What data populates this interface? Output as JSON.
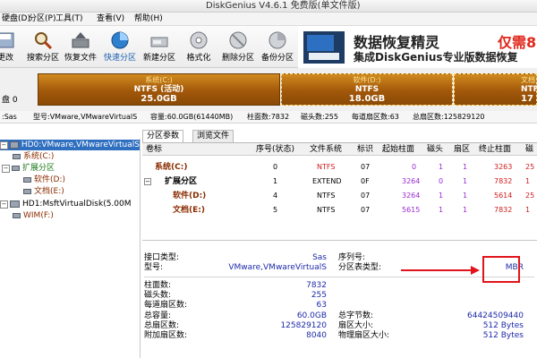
{
  "window": {
    "title": "DiskGenius V4.6.1 免费版(单文件版)"
  },
  "menu": [
    "硬盘(D)",
    "分区(P)",
    "工具(T)",
    "查看(V)",
    "帮助(H)"
  ],
  "toolbar": [
    {
      "label": "更改",
      "icon": "save-icon"
    },
    {
      "label": "搜索分区",
      "icon": "search-icon"
    },
    {
      "label": "恢复文件",
      "icon": "recover-file-icon"
    },
    {
      "label": "快速分区",
      "icon": "quick-partition-icon"
    },
    {
      "label": "新建分区",
      "icon": "new-partition-icon"
    },
    {
      "label": "格式化",
      "icon": "format-icon"
    },
    {
      "label": "删除分区",
      "icon": "delete-partition-icon"
    },
    {
      "label": "备份分区",
      "icon": "backup-partition-icon"
    }
  ],
  "ad": {
    "line1": "数据恢复精灵",
    "line1b": "仅需8",
    "line2": "集成DiskGenius专业版数据恢复"
  },
  "disk_label": "盘 0",
  "partitions_bar": [
    {
      "name": "系统(C:)",
      "fs": "NTFS (活动)",
      "size": "25.0GB"
    },
    {
      "name": "软件(D:)",
      "fs": "NTFS",
      "size": "18.0GB"
    },
    {
      "name": "文档",
      "fs": "NTF",
      "size": "17"
    }
  ],
  "info_bar": {
    "iface": ":Sas",
    "model": "型号:VMware,VMwareVirtualS",
    "capacity": "容量:60.0GB(61440MB)",
    "cyl": "柱面数:7832",
    "heads": "磁头数:255",
    "sectors_track": "每道扇区数:63",
    "total_sectors": "总扇区数:125829120"
  },
  "tree": [
    {
      "label": "HD0:VMware,VMwareVirtualS",
      "level": 0,
      "type": "disk",
      "expander": "-",
      "selected": true
    },
    {
      "label": "系统(C:)",
      "level": 1,
      "type": "part",
      "color": "#8a2c00"
    },
    {
      "label": "扩展分区",
      "level": 1,
      "type": "ext",
      "expander": "-",
      "color": "#1c7a1c"
    },
    {
      "label": "软件(D:)",
      "level": 2,
      "type": "part",
      "color": "#8a2c00"
    },
    {
      "label": "文档(E:)",
      "level": 2,
      "type": "part",
      "color": "#8a2c00"
    },
    {
      "label": "HD1:MsftVirtualDisk(5.00M",
      "level": 0,
      "type": "disk",
      "expander": "-"
    },
    {
      "label": "WIM(F:)",
      "level": 1,
      "type": "part",
      "color": "#8a2c00"
    }
  ],
  "tabs": [
    "分区参数",
    "浏览文件"
  ],
  "grid": {
    "headers": [
      "卷标",
      "序号(状态)",
      "文件系统",
      "标识",
      "起始柱面",
      "磁头",
      "扇区",
      "终止柱面",
      "磁"
    ],
    "rows": [
      {
        "name": "系统(C:)",
        "index": "0",
        "fs": "NTFS",
        "id": "07",
        "start_cyl": "0",
        "head": "1",
        "sector": "1",
        "end_cyl": "3263",
        "end_head": "25"
      },
      {
        "name": "扩展分区",
        "index": "1",
        "fs": "EXTEND",
        "id": "0F",
        "start_cyl": "3264",
        "head": "0",
        "sector": "1",
        "end_cyl": "7832",
        "end_head": "1"
      },
      {
        "name": "软件(D:)",
        "index": "4",
        "fs": "NTFS",
        "id": "07",
        "start_cyl": "3264",
        "head": "1",
        "sector": "1",
        "end_cyl": "5614",
        "end_head": "25"
      },
      {
        "name": "文档(E:)",
        "index": "5",
        "fs": "NTFS",
        "id": "07",
        "start_cyl": "5615",
        "head": "1",
        "sector": "1",
        "end_cyl": "7832",
        "end_head": "1"
      }
    ]
  },
  "details": {
    "iface_label": "接口类型:",
    "iface_value": "Sas",
    "model_label": "型号:",
    "model_value": "VMware,VMwareVirtualS",
    "serial_label": "序列号:",
    "ptable_label": "分区表类型:",
    "ptable_value": "MBR",
    "cyl_label": "柱面数:",
    "cyl_value": "7832",
    "heads_label": "磁头数:",
    "heads_value": "255",
    "spt_label": "每道扇区数:",
    "spt_value": "63",
    "cap_label": "总容量:",
    "cap_value": "60.0GB",
    "bytes_label": "总字节数:",
    "bytes_value": "64424509440",
    "ts_label": "总扇区数:",
    "ts_value": "125829120",
    "ss_label": "扇区大小:",
    "ss_value": "512 Bytes",
    "extra_label": "附加扇区数:",
    "extra_value": "8040",
    "pss_label": "物理扇区大小:",
    "pss_value": "512 Bytes"
  },
  "colors": {
    "partition": "#a2580a",
    "annotation": "#e0141a",
    "value": "#1d2aa8"
  }
}
